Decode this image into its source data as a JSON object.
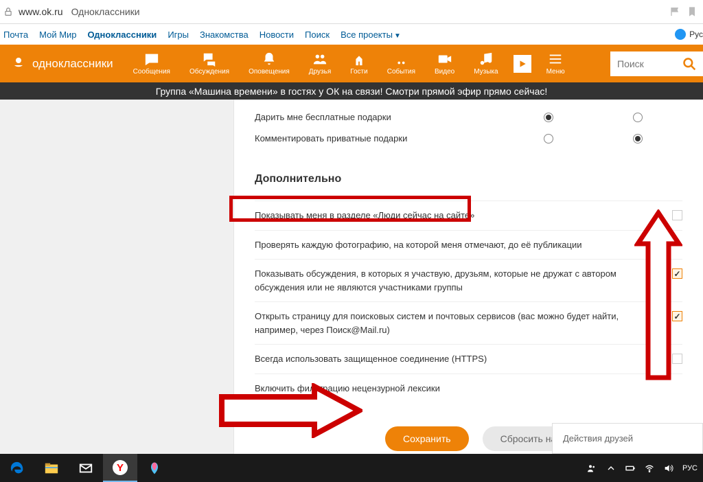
{
  "address_bar": {
    "url": "www.ok.ru",
    "title": "Одноклассники"
  },
  "mail_nav": {
    "items": [
      "Почта",
      "Мой Мир",
      "Одноклассники",
      "Игры",
      "Знакомства",
      "Новости",
      "Поиск",
      "Все проекты"
    ],
    "lang": "Рус"
  },
  "ok_header": {
    "logo": "одноклассники",
    "nav": [
      {
        "label": "Сообщения",
        "icon": "messages"
      },
      {
        "label": "Обсуждения",
        "icon": "discussions"
      },
      {
        "label": "Оповещения",
        "icon": "notifications"
      },
      {
        "label": "Друзья",
        "icon": "friends"
      },
      {
        "label": "Гости",
        "icon": "guests"
      },
      {
        "label": "События",
        "icon": "events"
      },
      {
        "label": "Видео",
        "icon": "video"
      },
      {
        "label": "Музыка",
        "icon": "music"
      }
    ],
    "menu_label": "Меню",
    "search_placeholder": "Поиск"
  },
  "banner": "Группа «Машина времени» в гостях у ОК на связи! Смотри прямой эфир прямо сейчас!",
  "settings": {
    "radio_rows": [
      {
        "label": "Дарить мне бесплатные подарки",
        "col1": true,
        "col2": false
      },
      {
        "label": "Комментировать приватные подарки",
        "col1": false,
        "col2": true
      }
    ],
    "section_title": "Дополнительно",
    "checkbox_rows": [
      {
        "label": "Показывать меня в разделе «Люди сейчас на сайте»",
        "checked": false
      },
      {
        "label": "Проверять каждую фотографию, на которой меня отмечают, до её публикации",
        "checked": false
      },
      {
        "label": "Показывать обсуждения, в которых я участвую, друзьям, которые не дружат с автором обсуждения или не являются участниками группы",
        "checked": true
      },
      {
        "label": "Открыть страницу для поисковых систем и почтовых сервисов (вас можно будет найти, например, через Поиск@Mail.ru)",
        "checked": true
      },
      {
        "label": "Всегда использовать защищенное соединение (HTTPS)",
        "checked": false
      },
      {
        "label": "Включить фильтрацию нецензурной лексики",
        "checked": false
      }
    ],
    "save_btn": "Сохранить",
    "reset_btn": "Сбросить настройки"
  },
  "friends_panel": "Действия друзей",
  "taskbar": {
    "lang": "РУС"
  }
}
